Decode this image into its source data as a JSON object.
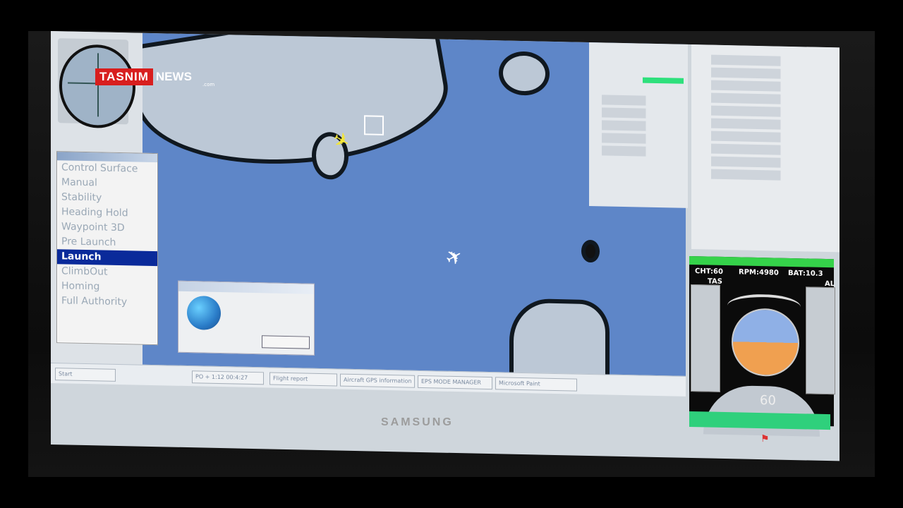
{
  "watermark": {
    "brand": "TASNIM",
    "suffix": "NEWS",
    "domain": ".com"
  },
  "monitor": {
    "brand": "SAMSUNG"
  },
  "modes": {
    "items": [
      {
        "label": "Control Surface"
      },
      {
        "label": "Manual"
      },
      {
        "label": "Stability"
      },
      {
        "label": "Heading Hold"
      },
      {
        "label": "Waypoint 3D"
      },
      {
        "label": "Pre Launch"
      },
      {
        "label": "Launch",
        "selected": true
      },
      {
        "label": "ClimbOut"
      },
      {
        "label": "Homing"
      },
      {
        "label": "Full Authority"
      }
    ]
  },
  "hud": {
    "cht": "CHT:60",
    "rpm": "RPM:4980",
    "bat": "BAT:10.3",
    "tas": "TAS",
    "alt_short": "AL",
    "heading": "60"
  },
  "taskbar": {
    "tasks": [
      {
        "label": "Start"
      },
      {
        "label": "PO + 1:12 00:4:27"
      },
      {
        "label": "Flight report"
      },
      {
        "label": "Aircraft GPS information"
      },
      {
        "label": "EPS MODE MANAGER"
      },
      {
        "label": "Microsoft Paint"
      }
    ]
  },
  "colors": {
    "sea": "#5e86c8",
    "land": "#bcc8d6",
    "selected": "#0a2a9a",
    "hud_green": "#35d24a",
    "aircraft_primary": "#f2e53a",
    "aircraft_secondary": "#ffffff"
  },
  "icons": {
    "compass": "compass-icon",
    "primary_aircraft": "airplane-yellow-icon",
    "secondary_aircraft": "airplane-white-icon"
  }
}
